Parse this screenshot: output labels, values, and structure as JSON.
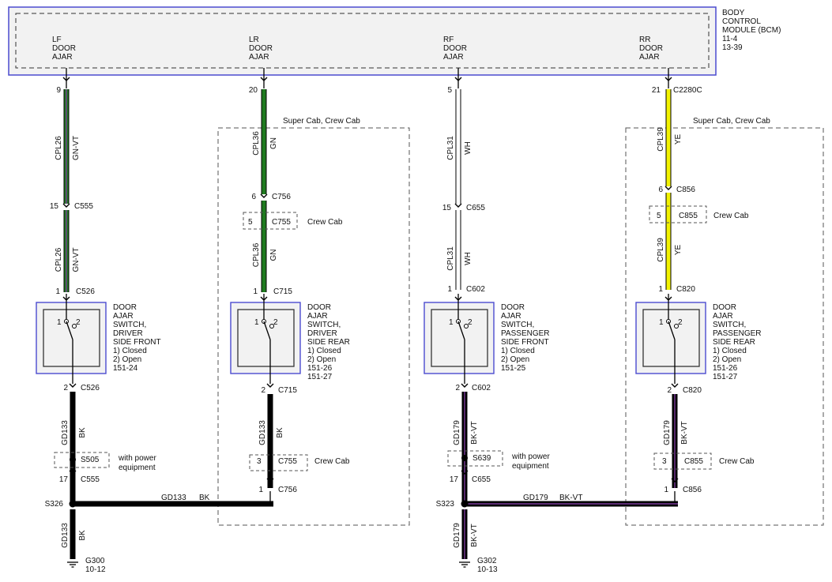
{
  "module": {
    "name": [
      "BODY",
      "CONTROL",
      "MODULE (BCM)",
      "11-4",
      "13-39"
    ]
  },
  "outputs": [
    {
      "label": [
        "LF",
        "DOOR",
        "AJAR"
      ],
      "pin": "9"
    },
    {
      "label": [
        "LR",
        "DOOR",
        "AJAR"
      ],
      "pin": "20"
    },
    {
      "label": [
        "RF",
        "DOOR",
        "AJAR"
      ],
      "pin": "5"
    },
    {
      "label": [
        "RR",
        "DOOR",
        "AJAR"
      ],
      "pin": "21",
      "connector": "C2280C"
    }
  ],
  "options": {
    "super_crew": "Super Cab, Crew Cab",
    "crew": "Crew Cab",
    "power": [
      "with power",
      "equipment"
    ]
  },
  "wires": {
    "lf_upper": {
      "circuit": "CPL26",
      "color": "GN-VT"
    },
    "lf_mid": {
      "circuit": "CPL26",
      "color": "GN-VT"
    },
    "lr_upper": {
      "circuit": "CPL36",
      "color": "GN"
    },
    "lr_mid": {
      "circuit": "CPL36",
      "color": "GN"
    },
    "rf_upper": {
      "circuit": "CPL31",
      "color": "WH"
    },
    "rf_mid": {
      "circuit": "CPL31",
      "color": "WH"
    },
    "rr_upper": {
      "circuit": "CPL39",
      "color": "YE"
    },
    "rr_mid": {
      "circuit": "CPL39",
      "color": "YE"
    },
    "lf_gnd": {
      "circuit": "GD133",
      "color": "BK"
    },
    "lr_gnd": {
      "circuit": "GD133",
      "color": "BK"
    },
    "rf_gnd": {
      "circuit": "GD179",
      "color": "BK-VT"
    },
    "rr_gnd": {
      "circuit": "GD179",
      "color": "BK-VT"
    },
    "left_h": {
      "circuit": "GD133",
      "color": "BK"
    },
    "right_h": {
      "circuit": "GD179",
      "color": "BK-VT"
    },
    "left_bottom": {
      "circuit": "GD133",
      "color": "BK"
    },
    "right_bottom": {
      "circuit": "GD179",
      "color": "BK-VT"
    }
  },
  "connectors": {
    "c555a": {
      "pin": "15",
      "name": "C555"
    },
    "c526a": {
      "pin": "1",
      "name": "C526"
    },
    "c526b": {
      "pin": "2",
      "name": "C526"
    },
    "s505": {
      "name": "S505"
    },
    "c555b": {
      "pin": "17",
      "name": "C555"
    },
    "s326": {
      "name": "S326"
    },
    "g300": {
      "name": "G300",
      "ref": "10-12"
    },
    "c756a": {
      "pin": "6",
      "name": "C756"
    },
    "c755a": {
      "pin": "5",
      "name": "C755"
    },
    "c715a": {
      "pin": "1",
      "name": "C715"
    },
    "c715b": {
      "pin": "2",
      "name": "C715"
    },
    "c755b": {
      "pin": "3",
      "name": "C755"
    },
    "c756b": {
      "pin": "1",
      "name": "C756"
    },
    "c655a": {
      "pin": "15",
      "name": "C655"
    },
    "c602a": {
      "pin": "1",
      "name": "C602"
    },
    "c602b": {
      "pin": "2",
      "name": "C602"
    },
    "s639": {
      "name": "S639"
    },
    "c655b": {
      "pin": "17",
      "name": "C655"
    },
    "s323": {
      "name": "S323"
    },
    "g302": {
      "name": "G302",
      "ref": "10-13"
    },
    "c856a": {
      "pin": "6",
      "name": "C856"
    },
    "c855a": {
      "pin": "5",
      "name": "C855"
    },
    "c820a": {
      "pin": "1",
      "name": "C820"
    },
    "c820b": {
      "pin": "2",
      "name": "C820"
    },
    "c855b": {
      "pin": "3",
      "name": "C855"
    },
    "c856b": {
      "pin": "1",
      "name": "C856"
    }
  },
  "switches": [
    {
      "label": [
        "DOOR",
        "AJAR",
        "SWITCH,",
        "DRIVER",
        "SIDE FRONT",
        "1) Closed",
        "2) Open",
        "151-24"
      ],
      "pin1": "1",
      "pin2": "2"
    },
    {
      "label": [
        "DOOR",
        "AJAR",
        "SWITCH,",
        "DRIVER",
        "SIDE REAR",
        "1) Closed",
        "2) Open",
        "151-26",
        "151-27"
      ],
      "pin1": "1",
      "pin2": "2"
    },
    {
      "label": [
        "DOOR",
        "AJAR",
        "SWITCH,",
        "PASSENGER",
        "SIDE FRONT",
        "1) Closed",
        "2) Open",
        "151-25"
      ],
      "pin1": "1",
      "pin2": "2"
    },
    {
      "label": [
        "DOOR",
        "AJAR",
        "SWITCH,",
        "PASSENGER",
        "SIDE REAR",
        "1) Closed",
        "2) Open",
        "151-26",
        "151-27"
      ],
      "pin1": "1",
      "pin2": "2"
    }
  ],
  "colors": {
    "green": "#1f7a1f",
    "violet": "#7a3a9a",
    "white": "#ffffff",
    "yellow": "#f2f200",
    "black": "#000000",
    "frame": "#4b4bcf"
  }
}
